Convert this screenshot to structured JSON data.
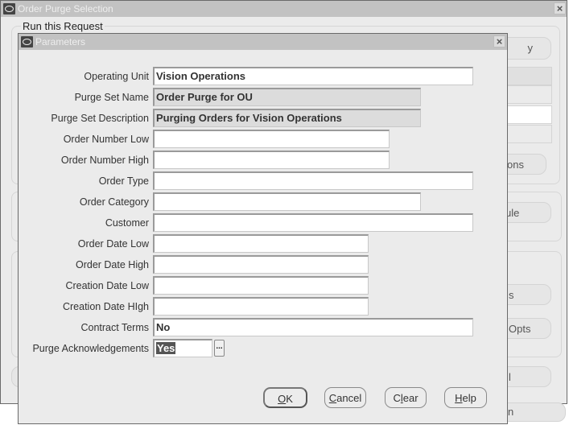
{
  "outer_window": {
    "title": "Order Purge Selection",
    "group_title": "Run this Request",
    "partial_buttons": [
      "y",
      "ons",
      "ule",
      "s",
      "Opts",
      "l",
      "n"
    ]
  },
  "params_dialog": {
    "title": "Parameters",
    "fields": [
      {
        "label": "Operating Unit",
        "value": "Vision Operations",
        "readonly": false
      },
      {
        "label": "Purge Set Name",
        "value": "Order Purge for OU",
        "readonly": true
      },
      {
        "label": "Purge Set Description",
        "value": "Purging Orders for Vision Operations",
        "readonly": true
      },
      {
        "label": "Order Number Low",
        "value": "",
        "readonly": false
      },
      {
        "label": "Order Number High",
        "value": "",
        "readonly": false
      },
      {
        "label": "Order Type",
        "value": "",
        "readonly": false
      },
      {
        "label": "Order Category",
        "value": "",
        "readonly": false
      },
      {
        "label": "Customer",
        "value": "",
        "readonly": false
      },
      {
        "label": "Order Date Low",
        "value": "",
        "readonly": false
      },
      {
        "label": "Order Date High",
        "value": "",
        "readonly": false
      },
      {
        "label": "Creation Date Low",
        "value": "",
        "readonly": false
      },
      {
        "label": "Creation Date HIgh",
        "value": "",
        "readonly": false
      },
      {
        "label": "Contract Terms",
        "value": "No",
        "readonly": false
      },
      {
        "label": "Purge Acknowledgements",
        "value": "Yes",
        "readonly": false
      }
    ],
    "lov_button": "...",
    "buttons": {
      "ok": {
        "mnemonic": "O",
        "rest": "K"
      },
      "cancel": {
        "mnemonic": "C",
        "rest": "ancel"
      },
      "clear": {
        "pre": "C",
        "mnemonic": "l",
        "rest": "ear"
      },
      "help": {
        "mnemonic": "H",
        "rest": "elp"
      }
    }
  },
  "icons": {
    "close": "×",
    "oracle_logo": "oracle-o-icon"
  }
}
